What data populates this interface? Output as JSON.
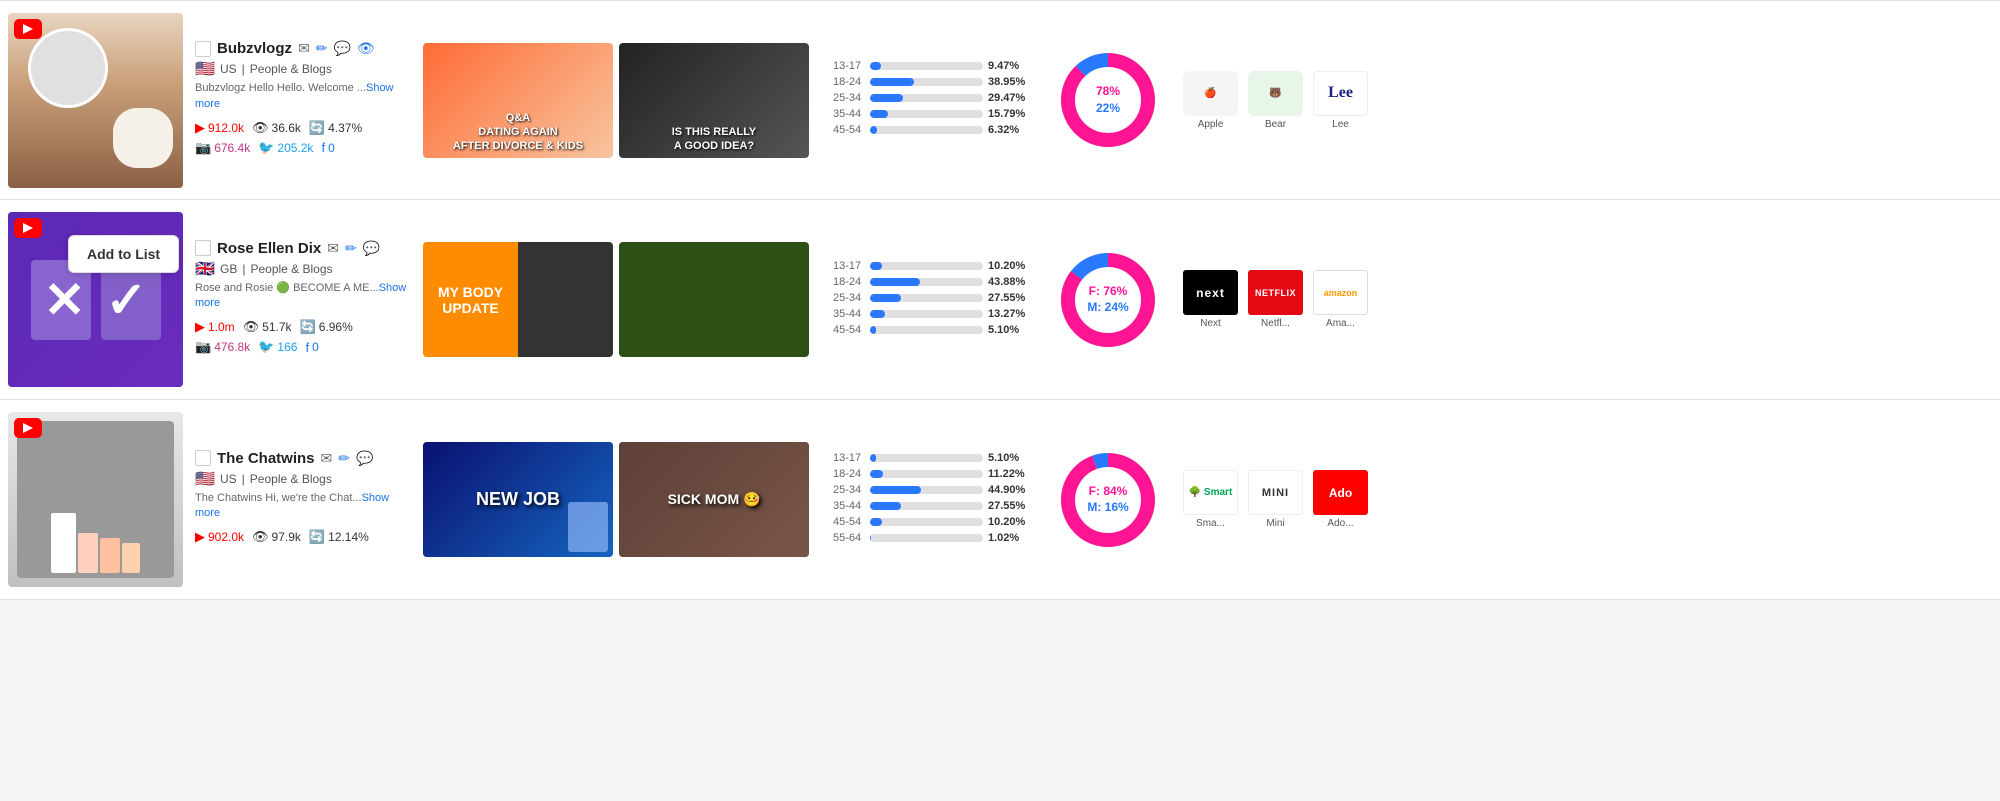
{
  "rows": [
    {
      "id": "bubzvlogz",
      "name": "Bubzvlogz",
      "country": "US",
      "category": "People & Blogs",
      "bio": "Bubzvlogz Hello Hello. Welcome ...",
      "yt_subs": "912.0k",
      "views": "36.6k",
      "engagement": "4.37%",
      "instagram": "676.4k",
      "twitter": "205.2k",
      "facebook": "0",
      "videos": [
        {
          "label": "Q&A DATING AGAIN AFTER DIVORCE & KIDS",
          "style": "vid-qa"
        },
        {
          "label": "IS THIS REALLY A GOOD IDEA?",
          "style": "vid-divorce"
        }
      ],
      "age_bars": [
        {
          "label": "13-17",
          "pct": 9.47,
          "display": "9.47%"
        },
        {
          "label": "18-24",
          "pct": 38.95,
          "display": "38.95%"
        },
        {
          "label": "25-34",
          "pct": 29.47,
          "display": "29.47%"
        },
        {
          "label": "35-44",
          "pct": 15.79,
          "display": "15.79%"
        },
        {
          "label": "45-54",
          "pct": 6.32,
          "display": "6.32%"
        }
      ],
      "female_pct": "78%",
      "male_pct": "22%",
      "brands": [
        {
          "name": "Apple",
          "style": "apple-icon",
          "symbol": "🍎"
        },
        {
          "name": "Bear",
          "style": "bear-icon",
          "symbol": "🐻"
        },
        {
          "name": "Lee",
          "style": "lee-icon",
          "symbol": "Lee"
        }
      ]
    },
    {
      "id": "roseellendix",
      "name": "Rose Ellen Dix",
      "country": "GB",
      "category": "People & Blogs",
      "bio": "Rose and Rosie 🟢 BECOME A ME...Show more",
      "yt_subs": "1.0m",
      "views": "51.7k",
      "engagement": "6.96%",
      "instagram": "476.8k",
      "twitter": "166",
      "facebook": "0",
      "videos": [
        {
          "label": "MY BODY UPDATE",
          "style": "vid-body"
        },
        {
          "label": "",
          "style": "vid-rosie"
        }
      ],
      "age_bars": [
        {
          "label": "13-17",
          "pct": 10.2,
          "display": "10.20%"
        },
        {
          "label": "18-24",
          "pct": 43.88,
          "display": "43.88%"
        },
        {
          "label": "25-34",
          "pct": 27.55,
          "display": "27.55%"
        },
        {
          "label": "35-44",
          "pct": 13.27,
          "display": "13.27%"
        },
        {
          "label": "45-54",
          "pct": 5.1,
          "display": "5.10%"
        }
      ],
      "female_pct": "76%",
      "male_pct": "24%",
      "brands": [
        {
          "name": "Next",
          "style": "next-icon",
          "symbol": "next"
        },
        {
          "name": "Netfl...",
          "style": "netflix-icon",
          "symbol": "NETFLIX"
        },
        {
          "name": "Ama...",
          "style": "amazon-icon",
          "symbol": "amazon"
        }
      ]
    },
    {
      "id": "thechatwins",
      "name": "The Chatwins",
      "country": "US",
      "category": "People & Blogs",
      "bio": "The Chatwins Hi, we're the Chat...Show more",
      "yt_subs": "902.0k",
      "views": "97.9k",
      "engagement": "12.14%",
      "instagram": "",
      "twitter": "",
      "facebook": "",
      "videos": [
        {
          "label": "NEW JOB",
          "style": "vid-newjob"
        },
        {
          "label": "SICK MOM 🤒",
          "style": "vid-sick"
        }
      ],
      "age_bars": [
        {
          "label": "13-17",
          "pct": 5.1,
          "display": "5.10%"
        },
        {
          "label": "18-24",
          "pct": 11.22,
          "display": "11.22%"
        },
        {
          "label": "25-34",
          "pct": 44.9,
          "display": "44.90%"
        },
        {
          "label": "35-44",
          "pct": 27.55,
          "display": "27.55%"
        },
        {
          "label": "45-54",
          "pct": 10.2,
          "display": "10.20%"
        },
        {
          "label": "55-64",
          "pct": 1.02,
          "display": "1.02%"
        }
      ],
      "female_pct": "84%",
      "male_pct": "16%",
      "brands": [
        {
          "name": "Sma...",
          "style": "smart-icon",
          "symbol": "Smart"
        },
        {
          "name": "Mini",
          "style": "mini-icon",
          "symbol": "Mini"
        },
        {
          "name": "Ado...",
          "style": "adobe-icon",
          "symbol": "Ado"
        }
      ]
    }
  ],
  "popup": {
    "label": "Add to List"
  }
}
